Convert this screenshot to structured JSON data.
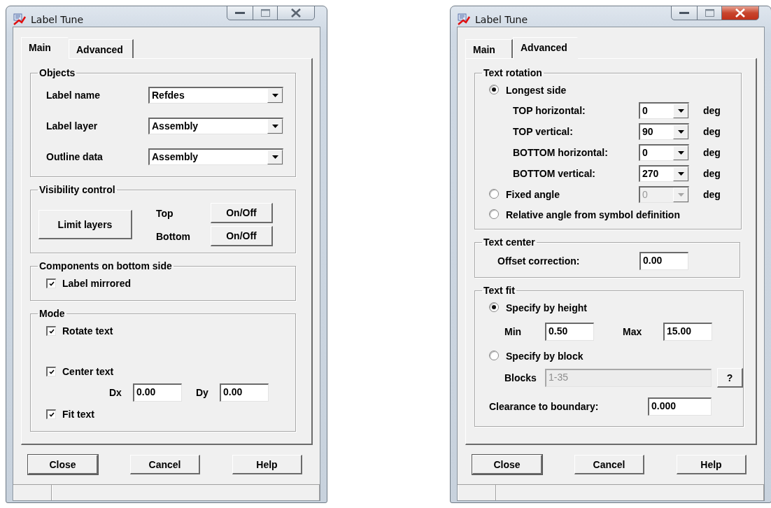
{
  "windows": [
    {
      "title": "Label Tune",
      "active": false,
      "tabs": [
        {
          "label": "Main",
          "selected": true
        },
        {
          "label": "Advanced",
          "selected": false
        }
      ],
      "groups": [
        {
          "title": "Objects",
          "kind": "objects",
          "items": [
            {
              "kind": "select",
              "label": "Label name",
              "value": "Refdes"
            },
            {
              "kind": "select",
              "label": "Label layer",
              "value": "Assembly"
            },
            {
              "kind": "select",
              "label": "Outline data",
              "value": "Assembly"
            }
          ]
        },
        {
          "title": "Visibility control",
          "kind": "visibility",
          "button": "Limit layers",
          "toggles": [
            {
              "label": "Top",
              "button": "On/Off"
            },
            {
              "label": "Bottom",
              "button": "On/Off"
            }
          ]
        },
        {
          "title": "Components on bottom side",
          "kind": "options",
          "items": [
            {
              "kind": "checkbox",
              "label": "Label mirrored",
              "checked": true
            }
          ]
        },
        {
          "title": "Mode",
          "kind": "options",
          "items": [
            {
              "kind": "checkbox",
              "label": "Rotate text",
              "checked": true
            },
            {
              "kind": "checkbox",
              "label": "Center text",
              "checked": true
            },
            {
              "kind": "pair",
              "fields": [
                {
                  "label": "Dx",
                  "value": "0.00"
                },
                {
                  "label": "Dy",
                  "value": "0.00"
                }
              ]
            },
            {
              "kind": "checkbox",
              "label": "Fit text",
              "checked": true
            }
          ]
        }
      ],
      "buttons": [
        "Close",
        "Cancel",
        "Help"
      ]
    },
    {
      "title": "Label Tune",
      "active": true,
      "tabs": [
        {
          "label": "Main",
          "selected": false
        },
        {
          "label": "Advanced",
          "selected": true
        }
      ],
      "groups": [
        {
          "title": "Text rotation",
          "kind": "rotation",
          "items": [
            {
              "kind": "radio",
              "label": "Longest side",
              "selected": true
            },
            {
              "kind": "angle",
              "label": "TOP horizontal:",
              "value": "0",
              "unit": "deg",
              "disabled": false
            },
            {
              "kind": "angle",
              "label": "TOP vertical:",
              "value": "90",
              "unit": "deg",
              "disabled": false
            },
            {
              "kind": "angle",
              "label": "BOTTOM horizontal:",
              "value": "0",
              "unit": "deg",
              "disabled": false
            },
            {
              "kind": "angle",
              "label": "BOTTOM vertical:",
              "value": "270",
              "unit": "deg",
              "disabled": false
            },
            {
              "kind": "radio",
              "label": "Fixed angle",
              "selected": false,
              "value": "0",
              "unit": "deg",
              "disabled": true
            },
            {
              "kind": "radio",
              "label": "Relative angle from symbol definition",
              "selected": false
            }
          ]
        },
        {
          "title": "Text center",
          "kind": "center",
          "items": [
            {
              "kind": "field",
              "label": "Offset correction:",
              "value": "0.00"
            }
          ]
        },
        {
          "title": "Text fit",
          "kind": "fit",
          "items": [
            {
              "kind": "radio",
              "label": "Specify by height",
              "selected": true
            },
            {
              "kind": "pair",
              "fields": [
                {
                  "label": "Min",
                  "value": "0.50"
                },
                {
                  "label": "Max",
                  "value": "15.00"
                }
              ]
            },
            {
              "kind": "radio",
              "label": "Specify by block",
              "selected": false
            },
            {
              "kind": "blocks",
              "label": "Blocks",
              "value": "1-35",
              "disabled": true,
              "button": "?"
            },
            {
              "kind": "field",
              "label": "Clearance to boundary:",
              "value": "0.000"
            }
          ]
        }
      ],
      "buttons": [
        "Close",
        "Cancel",
        "Help"
      ]
    }
  ]
}
